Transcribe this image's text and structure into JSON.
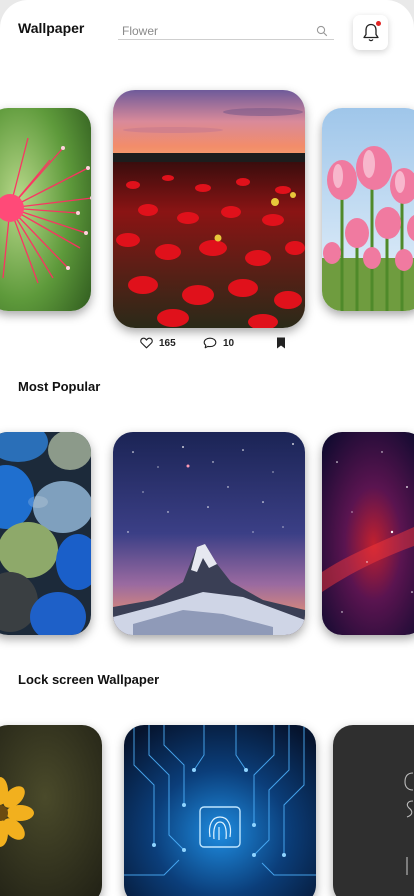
{
  "header": {
    "title": "Wallpaper",
    "search_placeholder": "Flower",
    "icons": {
      "search": "search-icon",
      "notifications": "bell-icon",
      "notification_dot_color": "#e02424"
    }
  },
  "featured": {
    "images": [
      "pink-flower-closeup",
      "red-poppy-field-sunset",
      "pink-tulips"
    ],
    "likes": "165",
    "comments": "10",
    "icons": {
      "like": "heart-icon",
      "comment": "comment-icon",
      "save": "bookmark-icon"
    }
  },
  "most_popular": {
    "title": "Most Popular",
    "images": [
      "blue-pebbles",
      "starry-mountain-peak",
      "nebula-space"
    ]
  },
  "lock_screen": {
    "title": "Lock screen Wallpaper",
    "images": [
      "yellow-flower-dark",
      "blue-circuit-fingerprint",
      "dark-quote"
    ]
  }
}
